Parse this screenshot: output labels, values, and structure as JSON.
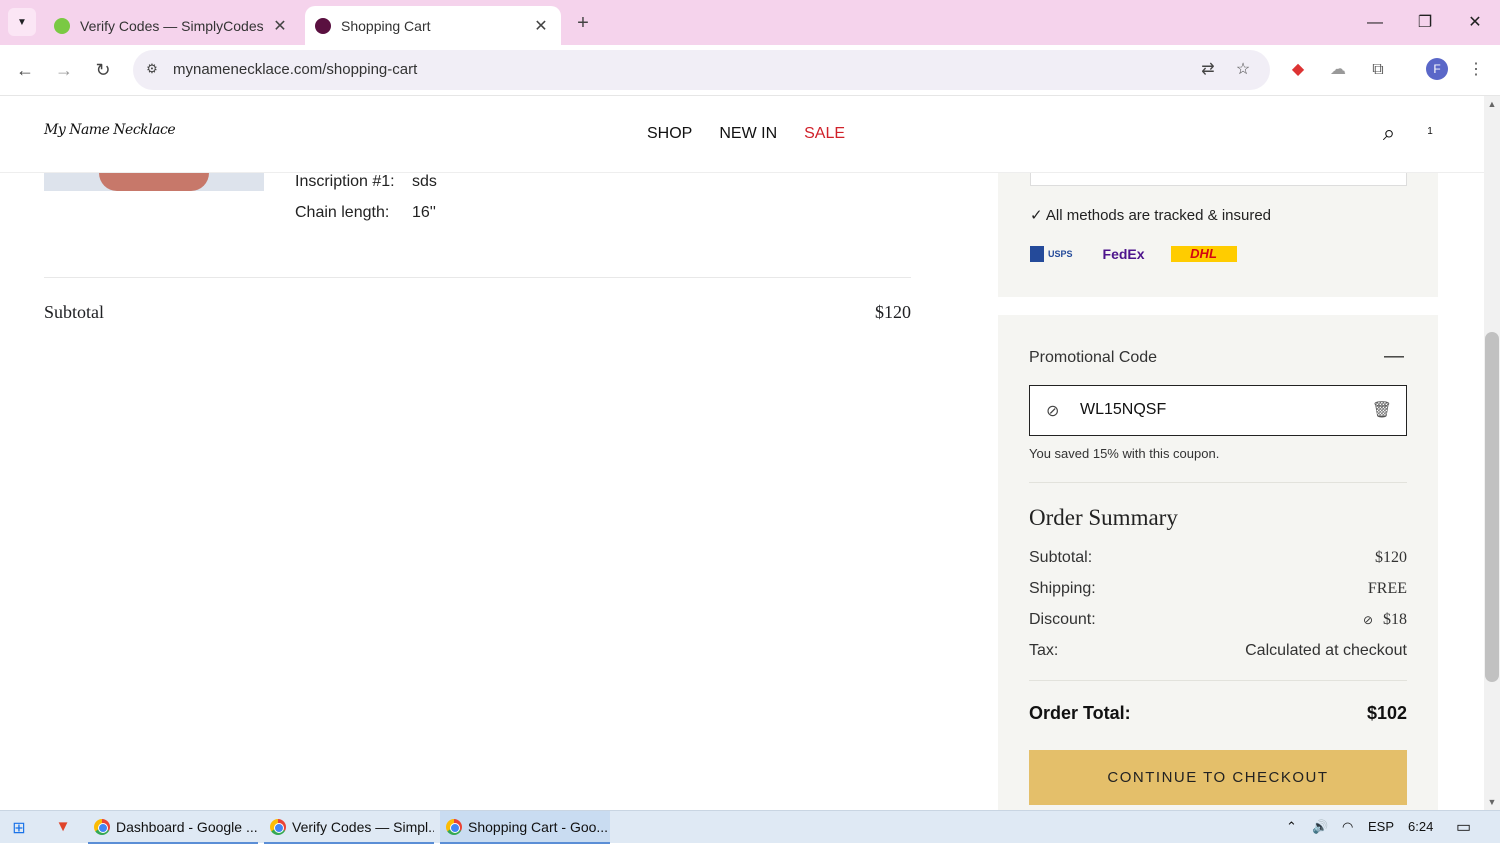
{
  "browser": {
    "tabs": [
      {
        "title": "Verify Codes — SimplyCodes",
        "active": false
      },
      {
        "title": "Shopping Cart",
        "active": true
      }
    ],
    "url": "mynamenecklace.com/shopping-cart",
    "profile_initial": "F"
  },
  "site": {
    "logo": "My Name Necklace",
    "nav": {
      "shop": "SHOP",
      "new_in": "NEW IN",
      "sale": "SALE"
    },
    "cart_count": "1"
  },
  "cart_item": {
    "attributes": [
      {
        "key": "Inscription #1:",
        "value": "sds"
      },
      {
        "key": "Chain length:",
        "value": "16''"
      }
    ]
  },
  "cart_subtotal": {
    "label": "Subtotal",
    "value": "$120"
  },
  "shipping": {
    "note": "✓ All methods are tracked & insured",
    "carriers": [
      "USPS",
      "FedEx",
      "DHL"
    ]
  },
  "promo": {
    "title": "Promotional Code",
    "code": "WL15NQSF",
    "saved_message": "You saved 15% with this coupon."
  },
  "order_summary": {
    "title": "Order Summary",
    "rows": [
      {
        "label": "Subtotal:",
        "value": "$120"
      },
      {
        "label": "Shipping:",
        "value": "FREE"
      },
      {
        "label": "Discount:",
        "value": "$18"
      },
      {
        "label": "Tax:",
        "value": "Calculated at checkout"
      }
    ],
    "total_label": "Order Total:",
    "total_value": "$102",
    "checkout_label": "CONTINUE TO CHECKOUT"
  },
  "taskbar": {
    "items": [
      {
        "label": "Dashboard - Google ..."
      },
      {
        "label": "Verify Codes — Simpl..."
      },
      {
        "label": "Shopping Cart - Goo..."
      }
    ],
    "language": "ESP",
    "time": "6:24"
  }
}
